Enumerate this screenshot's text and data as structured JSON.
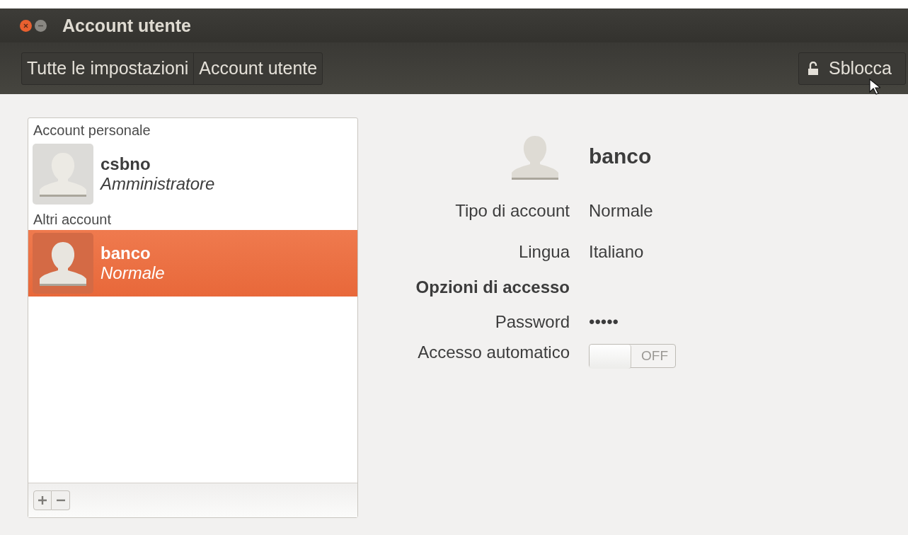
{
  "window": {
    "title": "Account utente"
  },
  "breadcrumbs": [
    {
      "label": "Tutte le impostazioni"
    },
    {
      "label": "Account utente"
    }
  ],
  "unlock_button": {
    "label": "Sblocca"
  },
  "account_list": {
    "sections": [
      {
        "heading": "Account personale",
        "accounts": [
          {
            "name": "csbno",
            "role": "Amministratore",
            "selected": false
          }
        ]
      },
      {
        "heading": "Altri account",
        "accounts": [
          {
            "name": "banco",
            "role": "Normale",
            "selected": true
          }
        ]
      }
    ]
  },
  "details": {
    "name": "banco",
    "fields": [
      {
        "kind": "text",
        "label": "Tipo di account",
        "value": "Normale"
      },
      {
        "kind": "text",
        "label": "Lingua",
        "value": "Italiano"
      },
      {
        "kind": "heading",
        "label": "Opzioni di accesso"
      },
      {
        "kind": "password",
        "label": "Password",
        "value": "•••••"
      },
      {
        "kind": "switch",
        "label": "Accesso automatico",
        "on": false,
        "state_text": "OFF"
      }
    ]
  }
}
